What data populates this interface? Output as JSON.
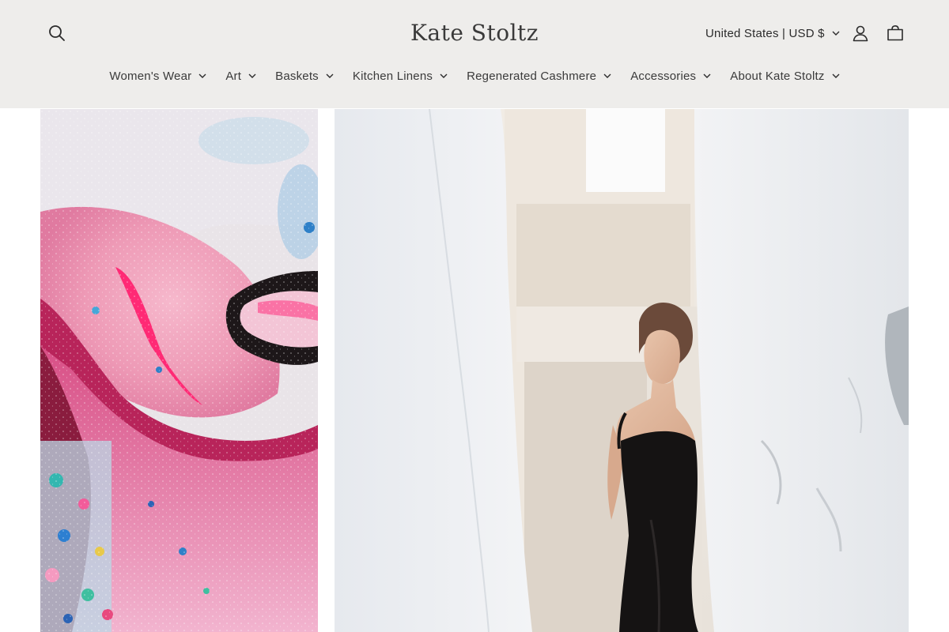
{
  "header": {
    "logo_text": "Kate Stoltz",
    "search_icon": "search-icon",
    "country_selector": "United States | USD $",
    "account_icon": "account-icon",
    "cart_icon": "cart-icon"
  },
  "nav": {
    "items": [
      {
        "label": "Women's Wear"
      },
      {
        "label": "Art"
      },
      {
        "label": "Baskets"
      },
      {
        "label": "Kitchen Linens"
      },
      {
        "label": "Regenerated Cashmere"
      },
      {
        "label": "Accessories"
      },
      {
        "label": "About Kate Stoltz"
      }
    ]
  },
  "colors": {
    "header_bg": "#eeedeb",
    "text": "#2b2b2b"
  }
}
